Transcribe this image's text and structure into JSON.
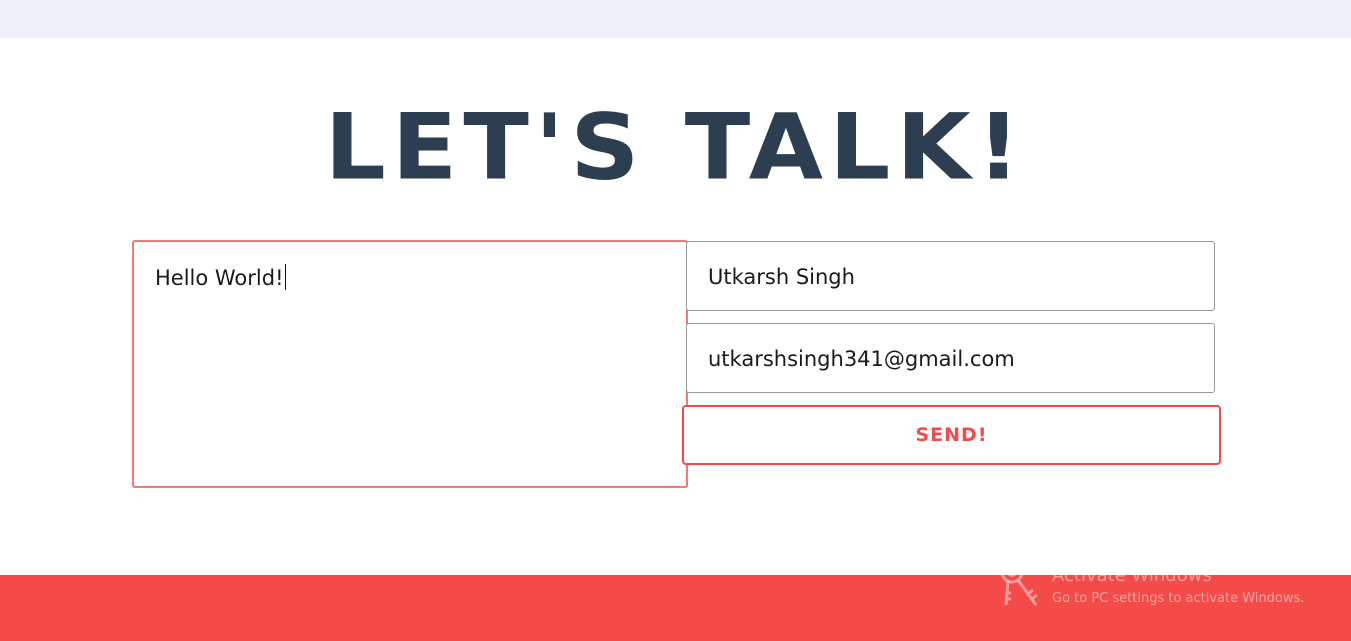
{
  "heading": "LET'S TALK!",
  "form": {
    "message_value": "Hello World!",
    "name_value": "Utkarsh Singh",
    "email_value": "utkarshsingh341@gmail.com",
    "send_label": "SEND!"
  },
  "watermark": {
    "title": "Activate Windows",
    "subtitle": "Go to PC settings to activate Windows.",
    "icon": "key-icon"
  },
  "colors": {
    "heading": "#2c3e50",
    "accent": "#f24b4b",
    "footer": "#f44a48",
    "top_bar": "#edf0f4"
  }
}
